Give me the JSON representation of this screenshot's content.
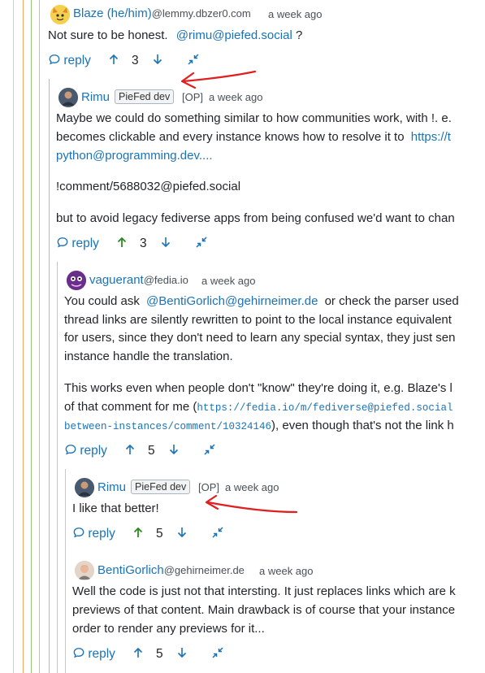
{
  "comments": [
    {
      "author": "Blaze (he/him)",
      "instance": "@lemmy.dbzer0.com",
      "time": "a week ago",
      "lines": [
        "Not sure to be honest.",
        "@rimu@piefed.social",
        "?"
      ],
      "actions": {
        "reply": "reply",
        "score": "3"
      }
    },
    {
      "author": "Rimu",
      "badge": "PieFed dev",
      "op": "[OP]",
      "time": "a week ago",
      "lines": [
        "Maybe we could do something similar to how communities work, with !. e.",
        "becomes clickable and every instance knows how to resolve it to",
        "https://t",
        "python@programming.dev....",
        "!comment/5688032@piefed.social",
        "but to avoid legacy fediverse apps from being confused we'd want to chan"
      ],
      "actions": {
        "reply": "reply",
        "score": "3"
      }
    },
    {
      "author": "vaguerant",
      "instance": "@fedia.io",
      "time": "a week ago",
      "lines": [
        "You could ask",
        "@BentiGorlich@gehirneimer.de",
        "or check the parser used",
        "thread links are silently rewritten to point to the local instance equivalent",
        "for users, since they don't need to learn any special syntax, they just sen",
        "instance handle the translation.",
        "This works even when people don't \"know\" they're doing it, e.g. Blaze's l",
        "of that comment for me (",
        "https://fedia.io/m/fediverse@piefed.social",
        "between-instances/comment/10324146",
        "), even though that's not the link h"
      ],
      "actions": {
        "reply": "reply",
        "score": "5"
      }
    },
    {
      "author": "Rimu",
      "badge": "PieFed dev",
      "op": "[OP]",
      "time": "a week ago",
      "lines": [
        "I like that better!"
      ],
      "actions": {
        "reply": "reply",
        "score": "5"
      }
    },
    {
      "author": "BentiGorlich",
      "instance": "@gehirneimer.de",
      "time": "a week ago",
      "lines": [
        "Well the code is just not that intersting. It just replaces links which are k",
        "previews of that content. Main drawback is of course that your instance",
        "order to render any previews for it..."
      ],
      "actions": {
        "reply": "reply",
        "score": "5"
      }
    }
  ],
  "icons": {
    "reply": "speech-bubble-icon",
    "upvote": "arrow-up-icon",
    "downvote": "arrow-down-icon",
    "collapse": "collapse-arrows-icon",
    "annotation": "red-arrow-annotation"
  },
  "colors": {
    "link": "#1a73b8",
    "upvoted": "#2a8a1f",
    "annotation": "#e02020",
    "thread_lines": [
      "#b6b6b6",
      "#f0a860",
      "#92c97a",
      "#7aa9e0",
      "#d9a3d1",
      "#e6c36a",
      "#b1b1b1"
    ]
  }
}
